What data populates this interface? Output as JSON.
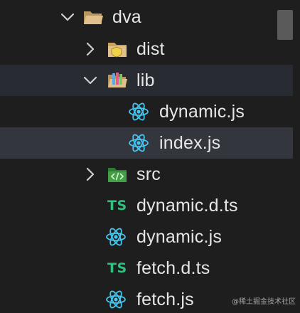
{
  "explorer": {
    "items": [
      {
        "label": "dva",
        "kind": "folder",
        "expanded": true,
        "icon": "folder-open-icon"
      },
      {
        "label": "dist",
        "kind": "folder",
        "expanded": false,
        "icon": "folder-dist-icon"
      },
      {
        "label": "lib",
        "kind": "folder",
        "expanded": true,
        "icon": "folder-lib-icon"
      },
      {
        "label": "dynamic.js",
        "kind": "file",
        "icon": "react-icon"
      },
      {
        "label": "index.js",
        "kind": "file",
        "icon": "react-icon",
        "selected": true
      },
      {
        "label": "src",
        "kind": "folder",
        "expanded": false,
        "icon": "folder-src-icon"
      },
      {
        "label": "dynamic.d.ts",
        "kind": "file",
        "icon": "typescript-icon",
        "badge": "TS"
      },
      {
        "label": "dynamic.js",
        "kind": "file",
        "icon": "react-icon"
      },
      {
        "label": "fetch.d.ts",
        "kind": "file",
        "icon": "typescript-icon",
        "badge": "TS"
      },
      {
        "label": "fetch.js",
        "kind": "file",
        "icon": "react-icon"
      }
    ]
  },
  "watermark": "@稀土掘金技术社区",
  "colors": {
    "background": "#1e1e1e",
    "selected_row": "#34363d",
    "react_icon": "#45c6f0",
    "typescript_badge": "#2ec27e",
    "folder": "#e2c08d"
  }
}
